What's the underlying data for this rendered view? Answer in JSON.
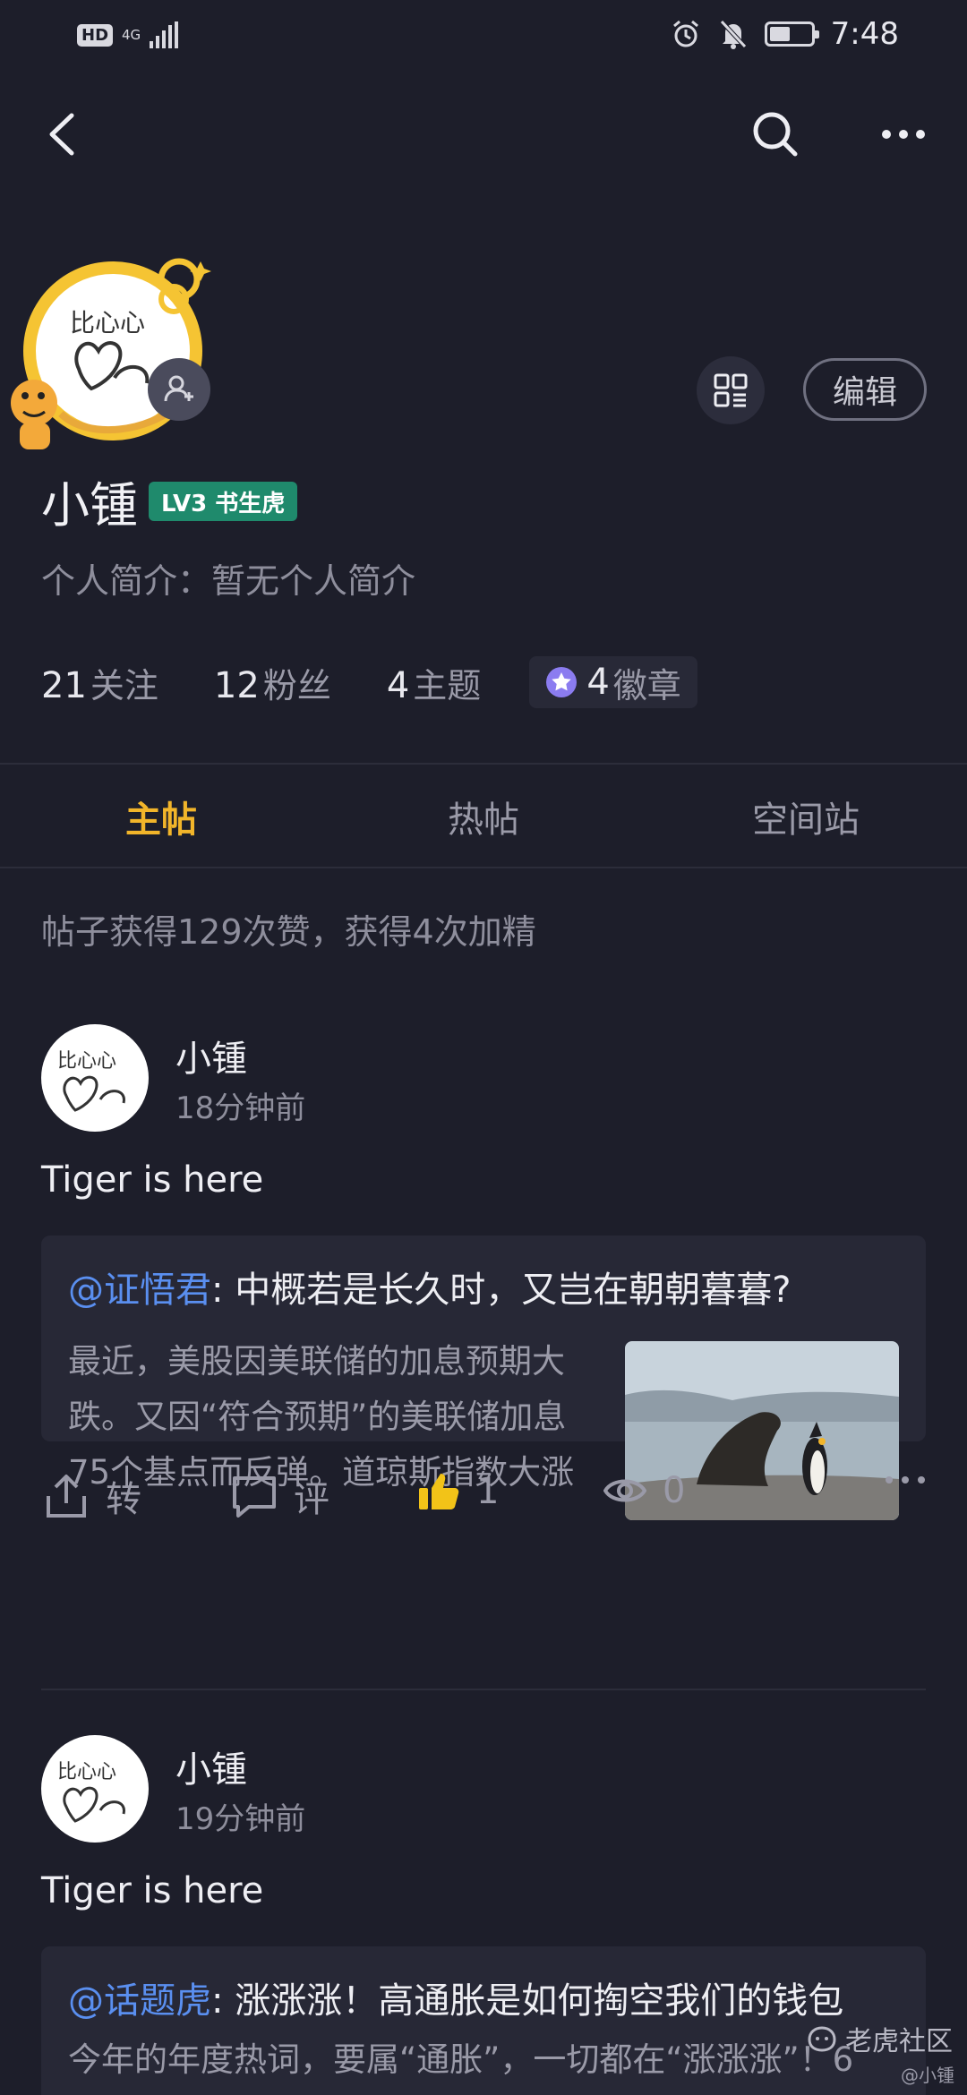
{
  "status_bar": {
    "network_badge": "HD",
    "network_type": "4G",
    "time": "7:48",
    "icons": [
      "alarm-icon",
      "mute-bell-icon",
      "battery-icon"
    ]
  },
  "nav": {
    "back_icon": "chevron-left-icon",
    "search_icon": "search-icon",
    "more_icon": "more-horizontal-icon"
  },
  "profile": {
    "username": "小锺",
    "level": "LV3 书生虎",
    "bio": "个人简介：暂无个人简介",
    "edit_label": "编辑",
    "stats": [
      {
        "num": "21",
        "label": "关注"
      },
      {
        "num": "12",
        "label": "粉丝"
      },
      {
        "num": "4",
        "label": "主题"
      }
    ],
    "badges": {
      "num": "4",
      "label": "徽章"
    }
  },
  "tabs": [
    {
      "label": "主帖",
      "active": true
    },
    {
      "label": "热帖",
      "active": false
    },
    {
      "label": "空间站",
      "active": false
    }
  ],
  "summary": "帖子获得129次赞，获得4次加精",
  "posts": [
    {
      "author": "小锺",
      "time": "18分钟前",
      "text": "Tiger is here",
      "card": {
        "mention": "@证悟君",
        "title": ": 中概若是长久时，又岂在朝朝暮暮?",
        "body": "最近，美股因美联储的加息预期大跌。又因“符合预期”的美联储加息75个基点而反弹。道琼斯指数大涨"
      },
      "actions": {
        "share_label": "转",
        "comment_label": "评",
        "like_count": "1",
        "view_count": "0"
      }
    },
    {
      "author": "小锺",
      "time": "19分钟前",
      "text": "Tiger is here",
      "card": {
        "mention": "@话题虎",
        "title": ": 涨涨涨！高通胀是如何掏空我们的钱包",
        "body": "今年的年度热词，要属“通胀”，一切都在“涨涨涨”！6"
      }
    }
  ],
  "watermark": {
    "brand": "老虎社区",
    "user": "@小锺"
  },
  "colors": {
    "background": "#1d1e2a",
    "accent": "#f2b52a",
    "mention": "#5a8ff0",
    "level_badge": "#1f8a6c"
  }
}
